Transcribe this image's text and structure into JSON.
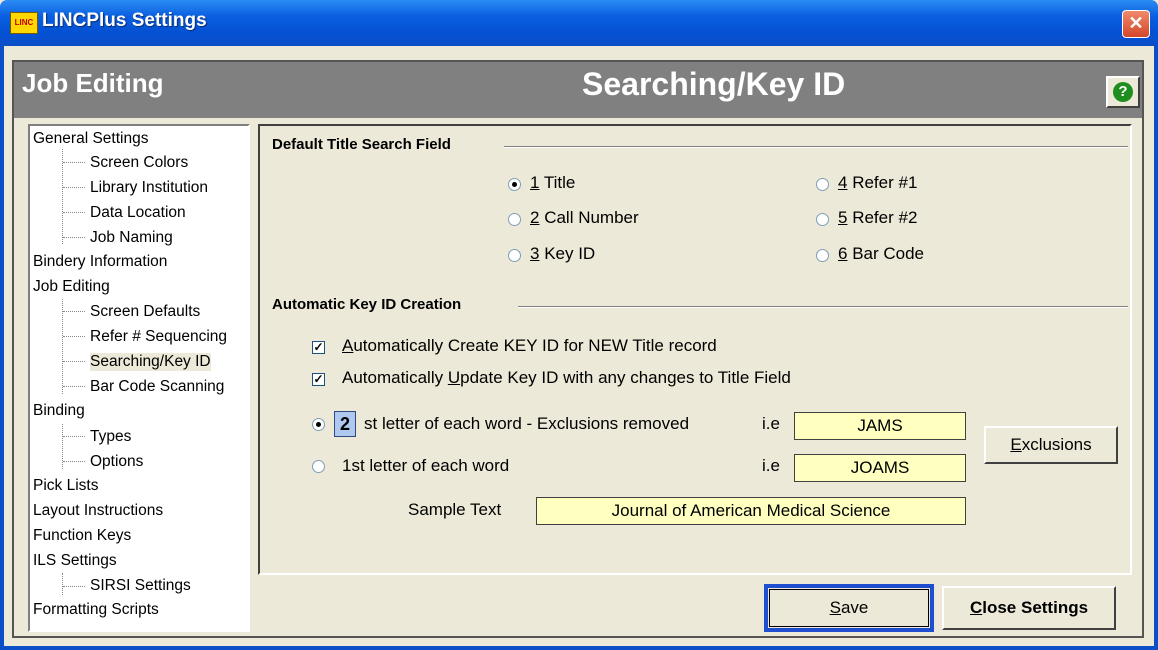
{
  "window": {
    "title": "LINCPlus Settings",
    "logo_text": "LINC",
    "close_glyph": "✕"
  },
  "header": {
    "section": "Job Editing",
    "page_title": "Searching/Key ID",
    "help_glyph": "?"
  },
  "tree": {
    "general": "General Settings",
    "screen_colors": "Screen Colors",
    "library_institution": "Library Institution",
    "data_location": "Data Location",
    "job_naming": "Job Naming",
    "bindery_information": "Bindery Information",
    "job_editing": "Job Editing",
    "screen_defaults": "Screen Defaults",
    "refer_sequencing": "Refer # Sequencing",
    "searching_key_id": "Searching/Key ID",
    "bar_code_scanning": "Bar Code Scanning",
    "binding": "Binding",
    "types": "Types",
    "options": "Options",
    "pick_lists": "Pick Lists",
    "layout_instructions": "Layout Instructions",
    "function_keys": "Function Keys",
    "ils_settings": "ILS Settings",
    "sirsi_settings": "SIRSI Settings",
    "formatting_scripts": "Formatting Scripts"
  },
  "search_field": {
    "heading": "Default Title Search Field",
    "opt1_num": "1",
    "opt1_text": " Title",
    "opt2_num": "2",
    "opt2_text": " Call Number",
    "opt3_num": "3",
    "opt3_text": " Key ID",
    "opt4_num": "4",
    "opt4_text": " Refer #1",
    "opt5_num": "5",
    "opt5_text": " Refer #2",
    "opt6_num": "6",
    "opt6_text": " Bar Code",
    "selected": "1"
  },
  "key_id": {
    "heading": "Automatic Key ID Creation",
    "auto_create_a": "A",
    "auto_create_b": "utomatically Create KEY ID for NEW Title record",
    "auto_update_a": "Automatically ",
    "auto_update_b": "U",
    "auto_update_c": "pdate Key ID with any changes to Title Field",
    "auto_create_checked": true,
    "auto_update_checked": true,
    "letters_count": "2",
    "option_a_text": "st  letter of each word - Exclusions removed",
    "option_a_ie": "i.e",
    "option_a_sample": "JAMS",
    "option_b_text": "1st letter of each word",
    "option_b_ie": "i.e",
    "option_b_sample": "JOAMS",
    "sample_label": "Sample Text",
    "sample_value": "Journal of American Medical Science",
    "exclusions_a": "E",
    "exclusions_b": "xclusions"
  },
  "footer": {
    "save_a": "S",
    "save_b": "ave",
    "close_a": "C",
    "close_b": "lose Settings"
  }
}
